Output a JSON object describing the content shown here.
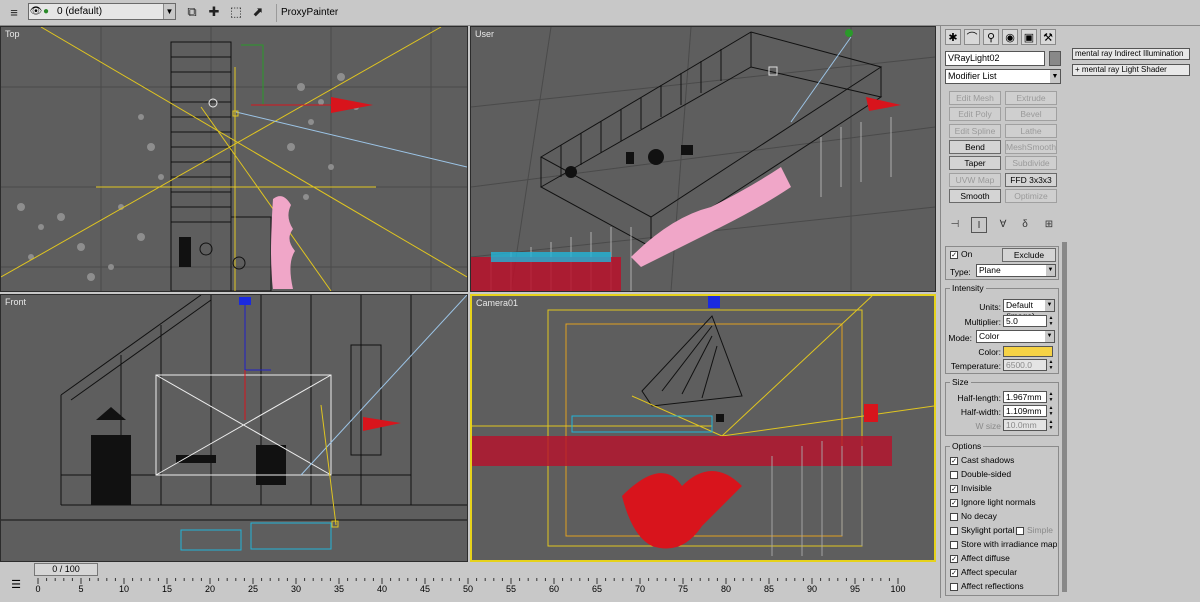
{
  "toolbar": {
    "layer_name": "0 (default)",
    "proxy_painter_label": "ProxyPainter"
  },
  "viewports": {
    "top_label": "Top",
    "user_label": "User",
    "front_label": "Front",
    "camera_label": "Camera01"
  },
  "command_panel": {
    "object_name": "VRayLight02",
    "modifier_list": "Modifier List",
    "modifier_buttons": [
      {
        "label": "Edit Mesh",
        "enabled": false
      },
      {
        "label": "Extrude",
        "enabled": false
      },
      {
        "label": "Edit Poly",
        "enabled": false
      },
      {
        "label": "Bevel",
        "enabled": false
      },
      {
        "label": "Edit Spline",
        "enabled": false
      },
      {
        "label": "Lathe",
        "enabled": false
      },
      {
        "label": "Bend",
        "enabled": true
      },
      {
        "label": "MeshSmooth",
        "enabled": false
      },
      {
        "label": "Taper",
        "enabled": true
      },
      {
        "label": "Subdivide",
        "enabled": false
      },
      {
        "label": "UVW Map",
        "enabled": false
      },
      {
        "label": "FFD 3x3x3",
        "enabled": true
      },
      {
        "label": "Smooth",
        "enabled": true
      },
      {
        "label": "Optimize",
        "enabled": false
      }
    ],
    "general": {
      "on_label": "On",
      "on_checked": true,
      "exclude_label": "Exclude",
      "type_label": "Type:",
      "type_value": "Plane"
    },
    "intensity": {
      "title": "Intensity",
      "units_label": "Units:",
      "units_value": "Default (image)",
      "multiplier_label": "Multiplier:",
      "multiplier_value": "5.0",
      "mode_label": "Mode:",
      "mode_value": "Color",
      "color_label": "Color:",
      "color_hex": "#f5d245",
      "temperature_label": "Temperature:",
      "temperature_value": "6500.0"
    },
    "size": {
      "title": "Size",
      "half_length_label": "Half-length:",
      "half_length_value": "1.967mm",
      "half_width_label": "Half-width:",
      "half_width_value": "1.109mm",
      "w_size_label": "W size",
      "w_size_value": "10.0mm"
    },
    "options": {
      "title": "Options",
      "items": [
        {
          "label": "Cast shadows",
          "checked": true
        },
        {
          "label": "Double-sided",
          "checked": false
        },
        {
          "label": "Invisible",
          "checked": true
        },
        {
          "label": "Ignore light normals",
          "checked": true
        },
        {
          "label": "No decay",
          "checked": false
        },
        {
          "label": "Skylight portal",
          "checked": false
        },
        {
          "label": "Store with irradiance map",
          "checked": false
        },
        {
          "label": "Affect diffuse",
          "checked": true
        },
        {
          "label": "Affect specular",
          "checked": true
        },
        {
          "label": "Affect reflections",
          "checked": false
        }
      ],
      "simple_label": "Simple"
    }
  },
  "shader_panel": {
    "item1": "mental ray Indirect Illumination",
    "item2": "mental ray Light Shader",
    "item2_prefix": "+"
  },
  "timeline": {
    "slider_label": "0 / 100",
    "ticks": [
      "0",
      "5",
      "10",
      "15",
      "20",
      "25",
      "30",
      "35",
      "40",
      "45",
      "50",
      "55",
      "60",
      "65",
      "70",
      "75",
      "80",
      "85",
      "90",
      "95",
      "100"
    ]
  },
  "colors": {
    "viewport_bg": "#5e5e5e",
    "active_border": "#e6d21b",
    "light_red": "#d8141c",
    "plant_pink": "#f0a6c8",
    "plant_cyan": "#22b4d8"
  }
}
